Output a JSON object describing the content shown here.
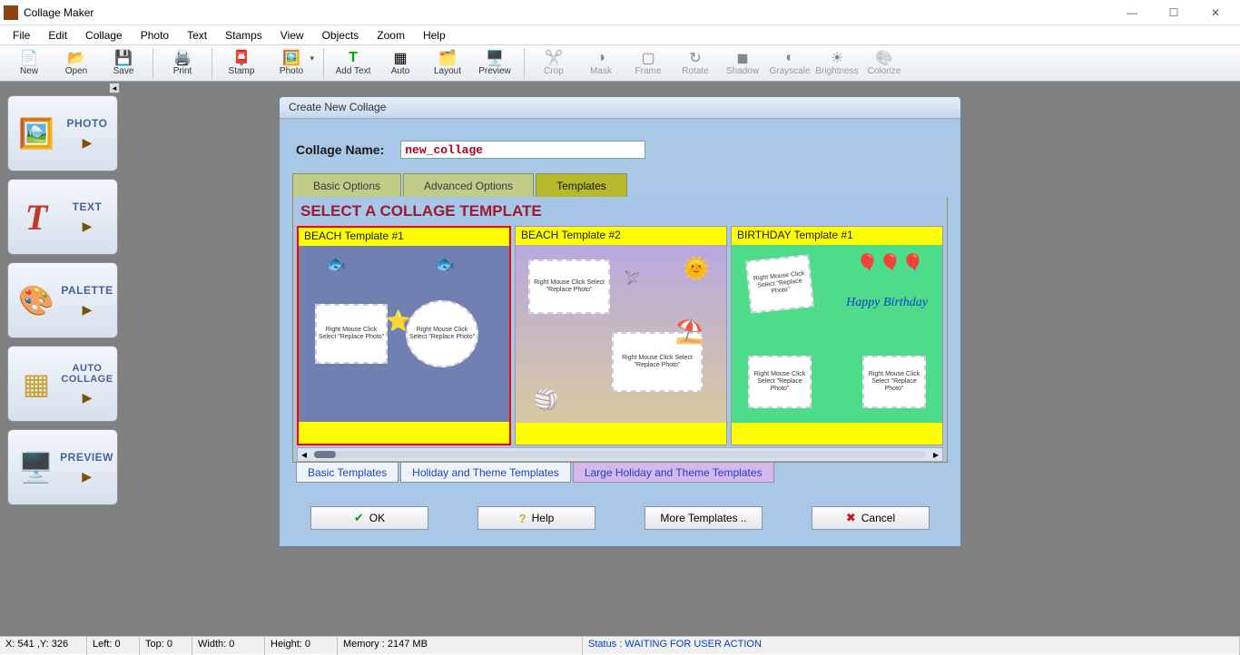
{
  "window": {
    "title": "Collage Maker"
  },
  "menubar": [
    "File",
    "Edit",
    "Collage",
    "Photo",
    "Text",
    "Stamps",
    "View",
    "Objects",
    "Zoom",
    "Help"
  ],
  "toolbar": {
    "groups": [
      [
        "New",
        "Open",
        "Save"
      ],
      [
        "Print"
      ],
      [
        "Stamp",
        "Photo"
      ],
      [
        "Add Text",
        "Auto",
        "Layout",
        "Preview"
      ],
      [
        "Crop",
        "Mask",
        "Frame",
        "Rotate",
        "Shadow",
        "Grayscale",
        "Brightness",
        "Colorize"
      ]
    ]
  },
  "leftpanel": {
    "items": [
      {
        "label": "PHOTO"
      },
      {
        "label": "TEXT"
      },
      {
        "label": "PALETTE"
      },
      {
        "label": "AUTO COLLAGE"
      },
      {
        "label": "PREVIEW"
      }
    ]
  },
  "dialog": {
    "title": "Create New Collage",
    "name_label": "Collage Name:",
    "name_value": "new_collage",
    "tabs": [
      "Basic Options",
      "Advanced Options",
      "Templates"
    ],
    "active_tab": 2,
    "section_title": "SELECT A COLLAGE TEMPLATE",
    "templates": [
      {
        "title": "BEACH Template #1",
        "selected": true
      },
      {
        "title": "BEACH Template #2",
        "selected": false
      },
      {
        "title": "BIRTHDAY Template #1",
        "selected": false
      }
    ],
    "placeholder_text": "Right Mouse Click\nSelect \"Replace Photo\"",
    "bottom_tabs": [
      "Basic Templates",
      "Holiday and Theme Templates",
      "Large Holiday and Theme Templates"
    ],
    "active_bottom_tab": 2,
    "buttons": {
      "ok": "OK",
      "help": "Help",
      "more": "More Templates ..",
      "cancel": "Cancel"
    }
  },
  "statusbar": {
    "coords": "X: 541 ,Y: 326",
    "left": "Left: 0",
    "top": "Top: 0",
    "width": "Width: 0",
    "height": "Height: 0",
    "memory": "Memory : 2147 MB",
    "status": "Status : WAITING FOR USER ACTION"
  }
}
